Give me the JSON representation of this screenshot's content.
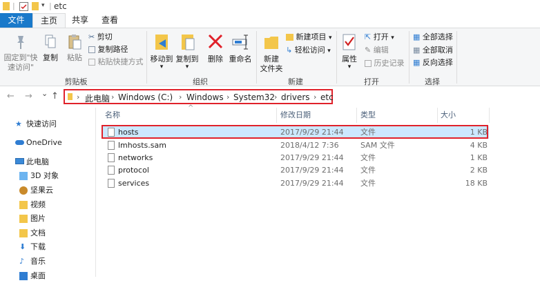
{
  "window": {
    "title": "etc",
    "separator": "|"
  },
  "tabs": [
    {
      "label": "文件"
    },
    {
      "label": "主页"
    },
    {
      "label": "共享"
    },
    {
      "label": "查看"
    }
  ],
  "ribbon": {
    "clipboard": {
      "pin_label_1": "固定到\"快",
      "pin_label_2": "速访问\"",
      "copy": "复制",
      "paste": "粘贴",
      "cut": "剪切",
      "copy_path": "复制路径",
      "paste_shortcut": "粘贴快捷方式",
      "group": "剪贴板"
    },
    "organize": {
      "move_to": "移动到",
      "copy_to": "复制到",
      "delete": "删除",
      "rename": "重命名",
      "group": "组织",
      "dropdown_glyph": "▾"
    },
    "new": {
      "new_folder_1": "新建",
      "new_folder_2": "文件夹",
      "new_item": "新建项目",
      "easy_access": "轻松访问",
      "group": "新建"
    },
    "open": {
      "properties": "属性",
      "open": "打开",
      "edit": "编辑",
      "history": "历史记录",
      "group": "打开"
    },
    "select": {
      "select_all": "全部选择",
      "select_none": "全部取消",
      "invert": "反向选择",
      "group": "选择"
    }
  },
  "address": {
    "back": "←",
    "forward": "→",
    "recent": "⌄",
    "up": "↑",
    "crumbs": [
      "此电脑",
      "Windows (C:)",
      "Windows",
      "System32",
      "drivers",
      "etc"
    ],
    "chevron": "›"
  },
  "navpane": [
    {
      "label": "快速访问",
      "icon": "star-icon"
    },
    {
      "label": "OneDrive",
      "icon": "cloud-icon"
    },
    {
      "label": "此电脑",
      "icon": "computer-icon"
    },
    {
      "label": "3D 对象",
      "icon": "cube-icon"
    },
    {
      "label": "坚果云",
      "icon": "nut-icon"
    },
    {
      "label": "视频",
      "icon": "video-icon"
    },
    {
      "label": "图片",
      "icon": "picture-icon"
    },
    {
      "label": "文档",
      "icon": "document-icon"
    },
    {
      "label": "下载",
      "icon": "download-icon"
    },
    {
      "label": "音乐",
      "icon": "music-icon"
    },
    {
      "label": "桌面",
      "icon": "desktop-icon"
    }
  ],
  "columns": {
    "name": "名称",
    "modified": "修改日期",
    "type": "类型",
    "size": "大小",
    "sort_glyph": "^"
  },
  "files": [
    {
      "name": "hosts",
      "modified": "2017/9/29 21:44",
      "type": "文件",
      "size": "1 KB"
    },
    {
      "name": "lmhosts.sam",
      "modified": "2018/4/12 7:36",
      "type": "SAM 文件",
      "size": "4 KB"
    },
    {
      "name": "networks",
      "modified": "2017/9/29 21:44",
      "type": "文件",
      "size": "1 KB"
    },
    {
      "name": "protocol",
      "modified": "2017/9/29 21:44",
      "type": "文件",
      "size": "2 KB"
    },
    {
      "name": "services",
      "modified": "2017/9/29 21:44",
      "type": "文件",
      "size": "18 KB"
    }
  ],
  "colors": {
    "accent": "#1979ca",
    "highlight": "#e0212a",
    "selection": "#cce8ff",
    "folder": "#f3c64a"
  }
}
